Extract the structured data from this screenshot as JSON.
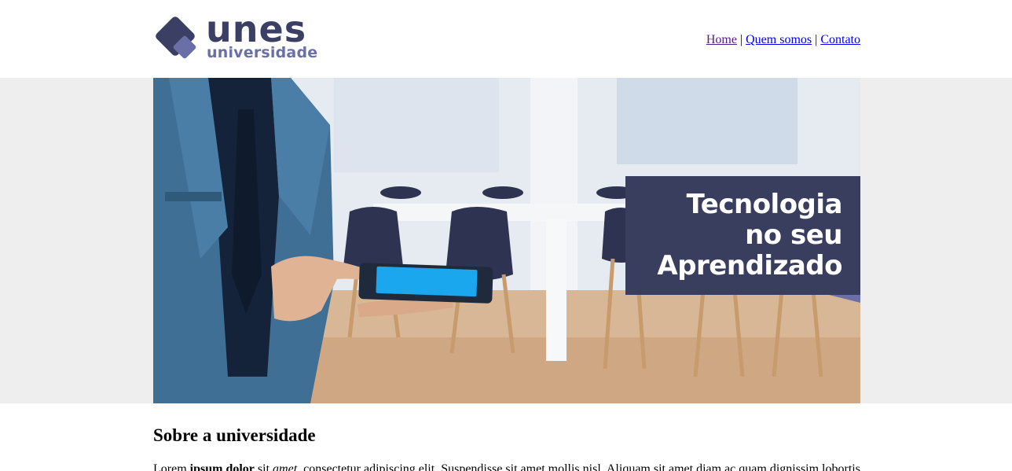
{
  "brand": {
    "name": "unes",
    "subtitle": "universidade",
    "colors": {
      "primary": "#3b3f63",
      "secondary": "#6a6fa8"
    }
  },
  "nav": {
    "items": [
      {
        "label": "Home",
        "visited": true
      },
      {
        "label": "Quem somos",
        "visited": false
      },
      {
        "label": "Contato",
        "visited": false
      }
    ],
    "separator": "|"
  },
  "banner": {
    "tagline": [
      "Tecnologia",
      "no seu",
      "Aprendizado"
    ],
    "band_color": "#eeeeee",
    "tagline_bg": "#3a3e5e"
  },
  "content": {
    "heading": "Sobre a universidade",
    "paragraph": {
      "part1": "Lorem ",
      "bold": "ipsum dolor",
      "part2": " sit ",
      "italic": "amet",
      "part3": ", consectetur adipiscing elit. Suspendisse sit amet mollis nisl. Aliquam sit amet diam ac quam dignissim lobortis."
    }
  }
}
